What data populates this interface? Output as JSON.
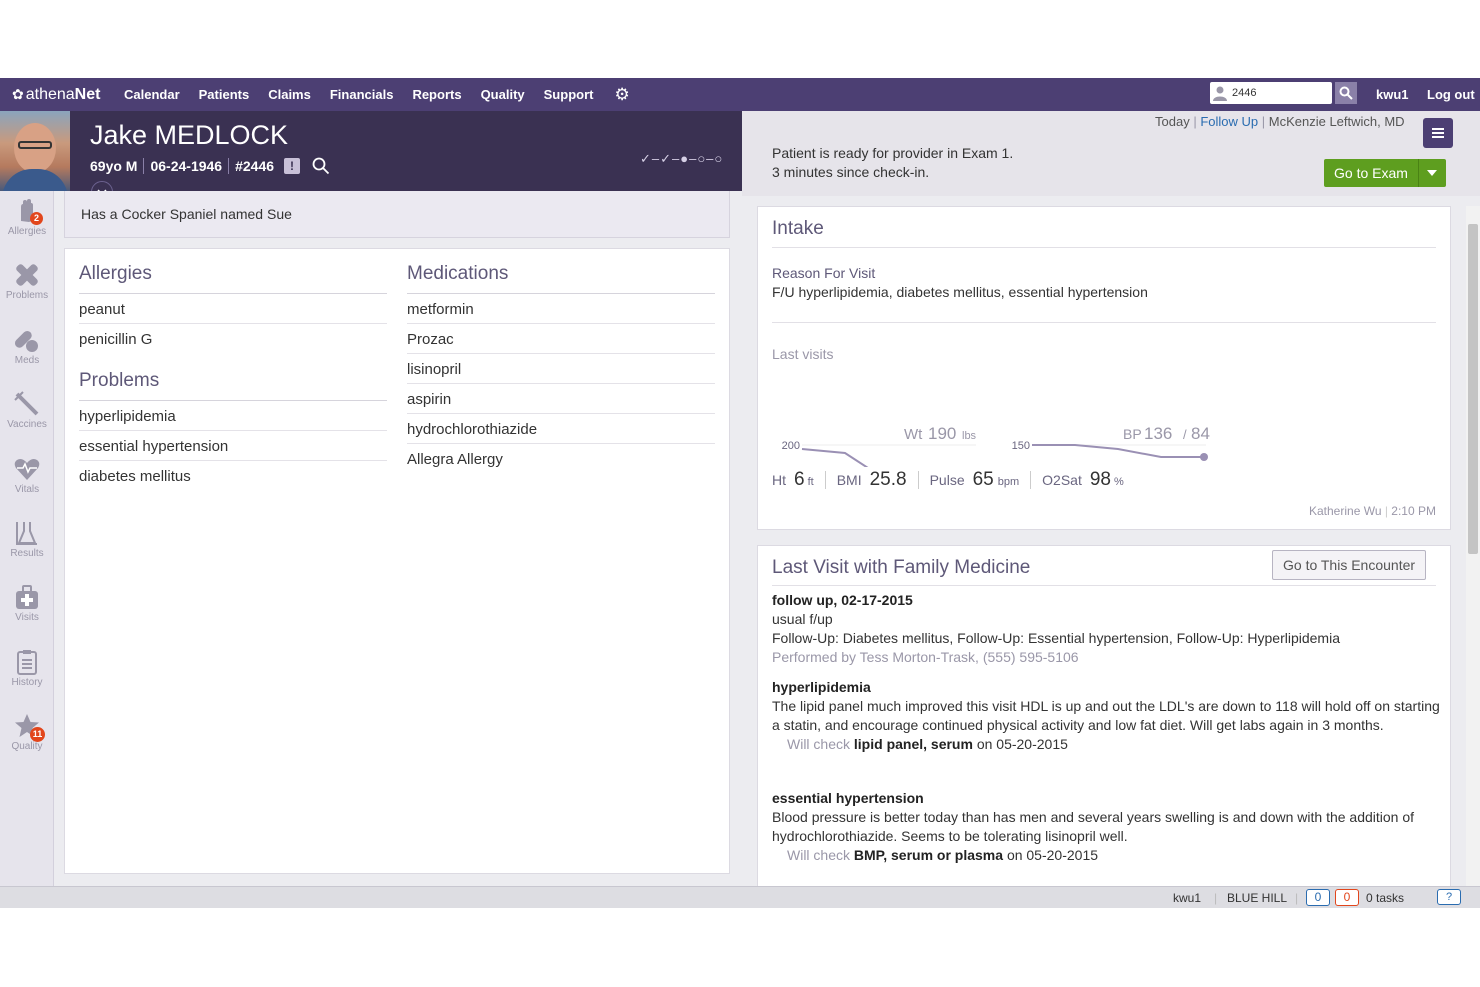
{
  "nav": {
    "logo_pre": "athena",
    "logo_post": "Net",
    "links": [
      "Calendar",
      "Patients",
      "Claims",
      "Financials",
      "Reports",
      "Quality",
      "Support"
    ],
    "search_value": "2446",
    "user": "kwu1",
    "logout": "Log out"
  },
  "patient": {
    "name": "Jake MEDLOCK",
    "age_sex": "69yo M",
    "dob": "06-24-1946",
    "id": "#2446",
    "alert_glyph": "!",
    "progress": "✓–✓–●–○–○",
    "note": "Has a Cocker Spaniel named Sue"
  },
  "sidebar": [
    {
      "label": "Allergies",
      "badge": "2",
      "icon": "hand-icon"
    },
    {
      "label": "Problems",
      "badge": "",
      "icon": "bandage-icon"
    },
    {
      "label": "Meds",
      "badge": "",
      "icon": "pills-icon"
    },
    {
      "label": "Vaccines",
      "badge": "",
      "icon": "syringe-icon"
    },
    {
      "label": "Vitals",
      "badge": "",
      "icon": "heart-icon"
    },
    {
      "label": "Results",
      "badge": "",
      "icon": "flask-icon"
    },
    {
      "label": "Visits",
      "badge": "",
      "icon": "medkit-icon"
    },
    {
      "label": "History",
      "badge": "",
      "icon": "clipboard-icon"
    },
    {
      "label": "Quality",
      "badge": "11",
      "icon": "star-icon"
    }
  ],
  "allergies": {
    "title": "Allergies",
    "items": [
      "peanut",
      "penicillin G"
    ]
  },
  "problems": {
    "title": "Problems",
    "items": [
      "hyperlipidemia",
      "essential hypertension",
      "diabetes mellitus"
    ]
  },
  "medications": {
    "title": "Medications",
    "items": [
      "metformin",
      "Prozac",
      "lisinopril",
      "aspirin",
      "hydrochlorothiazide",
      "Allegra Allergy"
    ]
  },
  "header_right": {
    "today": "Today",
    "follow_up": "Follow Up",
    "provider": "McKenzie Leftwich, MD",
    "ready_line1": "Patient is ready for provider in Exam 1.",
    "ready_line2": "3 minutes since check-in.",
    "go_exam": "Go to Exam"
  },
  "intake": {
    "title": "Intake",
    "reason_label": "Reason For Visit",
    "reason": "F/U hyperlipidemia, diabetes mellitus, essential hypertension",
    "last_visits": "Last visits",
    "wt_label": "Wt",
    "wt_value": "190",
    "wt_unit": "lbs",
    "wt_axis_top": "200",
    "wt_axis_bottom": "190",
    "bp_label": "BP",
    "bp_value": "136",
    "bp_sep": "/",
    "bp_value2": "84",
    "bp_axis_top": "150",
    "bp_axis_bottom": "84",
    "ht_label": "Ht",
    "ht_value": "6",
    "ht_unit": "ft",
    "bmi_label": "BMI",
    "bmi_value": "25.8",
    "pulse_label": "Pulse",
    "pulse_value": "65",
    "pulse_unit": "bpm",
    "o2_label": "O2Sat",
    "o2_value": "98",
    "o2_unit": "%",
    "recorded_by": "Katherine Wu",
    "recorded_time": "2:10 PM",
    "wt_trend": [
      199,
      198,
      191,
      194,
      191
    ],
    "bp_sys_trend": [
      150,
      150,
      149,
      147,
      147
    ],
    "bp_dia_trend": [
      84,
      84,
      83,
      83,
      83
    ]
  },
  "last_visit": {
    "title": "Last Visit with Family Medicine",
    "go_encounter": "Go to This Encounter",
    "visit_header": "follow up, 02-17-2015",
    "visit_reason": "usual f/up",
    "visit_dx": "Follow-Up: Diabetes mellitus, Follow-Up: Essential hypertension, Follow-Up: Hyperlipidemia",
    "performed_by": "Performed by Tess Morton-Trask, (555) 595-5106",
    "sections": [
      {
        "heading": "hyperlipidemia",
        "body": "The lipid panel much improved this visit HDL is up and out the LDL's are down to 118 will hold off on starting a statin, and encourage continued physical activity and low fat diet. Will get labs again in 3 months.",
        "check_pre": "Will check",
        "check_item": "lipid panel, serum",
        "check_post": "on 05-20-2015"
      },
      {
        "heading": "essential hypertension",
        "body": "Blood pressure is better today than has men and several years swelling is and down with the addition of hydrochlorothiazide. Seems to be tolerating lisinopril well.",
        "check_pre": "Will check",
        "check_item": "BMP, serum or plasma",
        "check_post": "on 05-20-2015"
      }
    ]
  },
  "status": {
    "user": "kwu1",
    "location": "BLUE HILL",
    "count_blue": "0",
    "count_orange": "0",
    "tasks": "0 tasks",
    "help_glyph": "?"
  },
  "colors": {
    "nav": "#4c3f73",
    "banner": "#3a3152",
    "accent_green": "#5e9e1f",
    "badge": "#e2461c",
    "link": "#2a6cb0"
  }
}
